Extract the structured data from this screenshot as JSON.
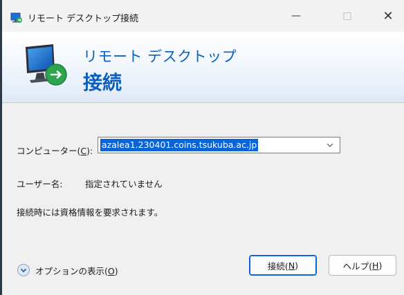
{
  "window": {
    "title": "リモート デスクトップ接続",
    "icon": "remote-desktop-icon",
    "minimize": "—",
    "maximize": "□",
    "close": "✕"
  },
  "banner": {
    "line1": "リモート デスクトップ",
    "line2": "接続",
    "icon": "remote-desktop-monitor-icon"
  },
  "form": {
    "computer_label_pre": "コンピューター(",
    "computer_label_key": "C",
    "computer_label_post": "):",
    "computer_value": "azalea1.230401.coins.tsukuba.ac.jp",
    "user_label": "ユーザー名:",
    "user_value": "指定されていません",
    "info": "接続時には資格情報を要求されます。"
  },
  "footer": {
    "options_pre": "オプションの表示(",
    "options_key": "O",
    "options_post": ")",
    "options_icon": "chevron-down-circle-icon",
    "connect_pre": "接続(",
    "connect_key": "N",
    "connect_post": ")",
    "help_pre": "ヘルプ(",
    "help_key": "H",
    "help_post": ")"
  },
  "colors": {
    "accent": "#0a64d8",
    "banner_text": "#0b5fbf"
  }
}
